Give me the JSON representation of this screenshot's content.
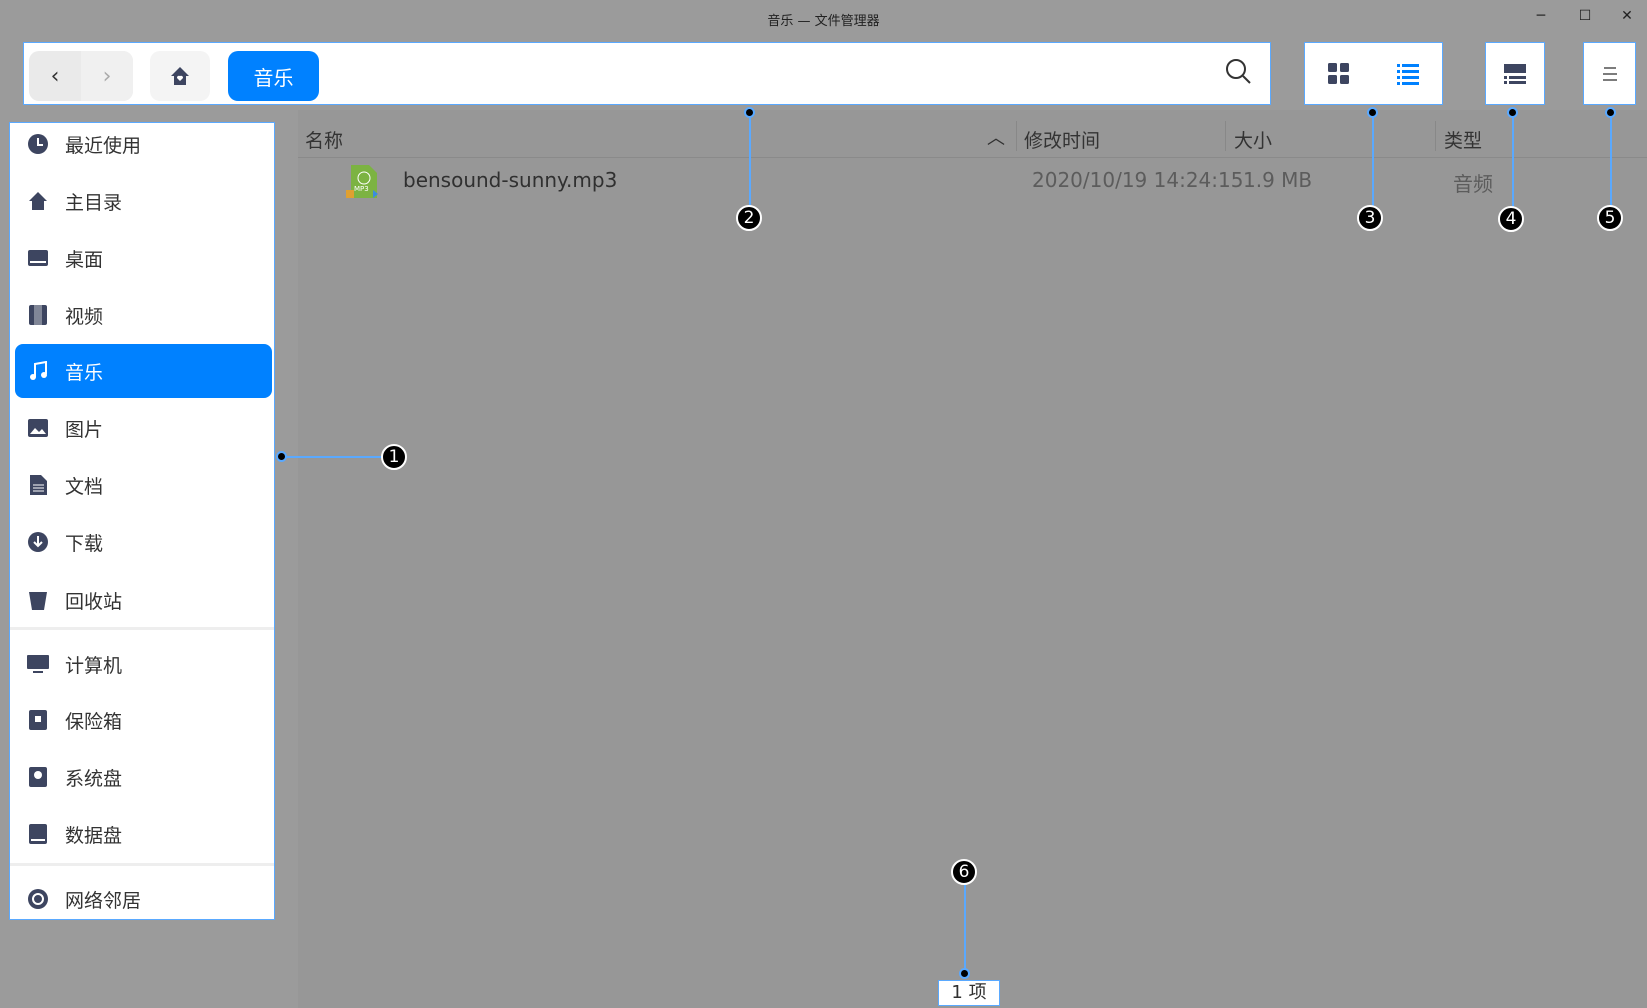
{
  "window": {
    "title": "音乐 — 文件管理器",
    "minimize": "─",
    "maximize": "☐",
    "close": "✕"
  },
  "toolbar": {
    "back": "‹",
    "forward": "›",
    "breadcrumb": "音乐"
  },
  "sidebar": {
    "items": [
      {
        "label": "最近使用",
        "icon": "clock-icon"
      },
      {
        "label": "主目录",
        "icon": "home-icon"
      },
      {
        "label": "桌面",
        "icon": "desktop-icon"
      },
      {
        "label": "视频",
        "icon": "film-icon"
      },
      {
        "label": "音乐",
        "icon": "music-icon",
        "selected": true
      },
      {
        "label": "图片",
        "icon": "image-icon"
      },
      {
        "label": "文档",
        "icon": "document-icon"
      },
      {
        "label": "下载",
        "icon": "download-icon"
      },
      {
        "label": "回收站",
        "icon": "trash-icon"
      },
      {
        "label": "计算机",
        "icon": "computer-icon"
      },
      {
        "label": "保险箱",
        "icon": "vault-icon"
      },
      {
        "label": "系统盘",
        "icon": "disk-icon"
      },
      {
        "label": "数据盘",
        "icon": "disk-icon"
      },
      {
        "label": "网络邻居",
        "icon": "network-icon"
      }
    ]
  },
  "columns": {
    "name": "名称",
    "modified": "修改时间",
    "size": "大小",
    "type": "类型"
  },
  "files": [
    {
      "name": "bensound-sunny.mp3",
      "modified": "2020/10/19 14:24:15",
      "size": "1.9 MB",
      "type": "音频"
    }
  ],
  "status": "1 项",
  "callouts": [
    "1",
    "2",
    "3",
    "4",
    "5",
    "6"
  ],
  "colors": {
    "accent": "#0081ff",
    "outline": "#5aa9ff"
  }
}
